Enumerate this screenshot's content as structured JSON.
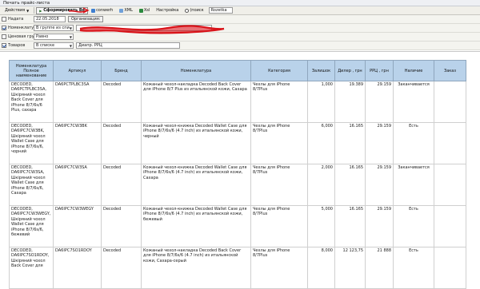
{
  "window": {
    "title": "Печать прайс-листа"
  },
  "toolbar": {
    "actions_label": "Действия",
    "generate_label": "Сформировать Ве",
    "convert_label": "conwerh",
    "xml_label": "XML",
    "xsl_label": "Xsl",
    "settings_label": "Настройка",
    "search_label": "(поиск",
    "search_value": "Rozetka"
  },
  "filters": {
    "as_of": {
      "label": "Надата",
      "checked": false,
      "date": "22.05.2018",
      "button_label": "Организация:"
    },
    "nomenclature": {
      "label": "Номенклатура",
      "checked": true,
      "mode": "В группе из спи"
    },
    "price_group": {
      "label": "Ценовая группа",
      "checked": false,
      "mode": "Равно"
    },
    "goods": {
      "label": "Товаров",
      "checked": true,
      "mode": "В списке",
      "value": "Диапр. РРЦ"
    }
  },
  "table": {
    "columns": [
      "Номенклатура Полное наименование",
      "Артикул",
      "Бренд",
      "Номенклатура",
      "Категория",
      "Залишок",
      "Дилер , грн",
      "РРЦ , грн",
      "Наличие",
      "Заказ"
    ],
    "rows": [
      {
        "full_name": "DECODED, DA6PCTPLBC3SA, Шкіряний чохол Back Cover для iPhone 8/7/6s/6 Plus, сахара",
        "article": "DA6PCTPLBC3SA",
        "brand": "Decoded",
        "name": "Кожаный чехол-накладка Decoded Back Cover для iPhone 8/7 Plus из итальянской кожи, Сахара",
        "category": "Чехлы для iPhone 8/7Plus",
        "stock": "1,000",
        "dealer": "19.389",
        "rrp": "29.159",
        "availability": "Заканчивается",
        "order": ""
      },
      {
        "full_name": "DECODED, DA6IPC7CW3BK, Шкіряний чохол Wallet Case для iPhone 8/7/6s/6, чорний",
        "article": "DA6IPC7CW3BK",
        "brand": "Decoded",
        "name": "Кожаный чехол-книжка Decoded Wallet Case для iPhone 8/7/6s/6 (4.7 inch) из итальянской кожи, черный",
        "category": "Чехлы для iPhone 8/7Plus",
        "stock": "6,000",
        "dealer": "16.165",
        "rrp": "29.159",
        "availability": "Есть",
        "order": ""
      },
      {
        "full_name": "DECODED, DA6IPC7CW3SA, Шкіряний чохол Wallet Case для iPhone 8/7/6s/6, Сахара",
        "article": "DA6IPC7CW3SA",
        "brand": "Decoded",
        "name": "Кожаный чехол-книжка Decoded Wallet Case для iPhone 8/7/6s/6 (4.7 inch) из итальянской кожи, Сахара",
        "category": "Чехлы для iPhone 8/7Plus",
        "stock": "2,000",
        "dealer": "16.165",
        "rrp": "29.159",
        "availability": "Заканчивается",
        "order": ""
      },
      {
        "full_name": "DECODED, DA6IPC7CW3WEGY, Шкіряний чохол Wallet Case для iPhone 8/7/6s/6, бежевий",
        "article": "DA6IPC7CW3WEGY",
        "brand": "Decoded",
        "name": "Кожаный чехол-книжка Decoded Wallet Case для iPhone 8/7/6s/6 (4.7 inch) из итальянской кожи, бежевый",
        "category": "Чехлы для iPhone 8/7Plus",
        "stock": "5,000",
        "dealer": "16.165",
        "rrp": "29.159",
        "availability": "Есть",
        "order": ""
      },
      {
        "full_name": "DECODED, DA6IPC7SO1RDOY, Шкіряний чохол Back Cover для",
        "article": "DA6IPC7SO1RDOY",
        "brand": "Decoded",
        "name": "Кожаный чехол-накладка Decoded Back Cover для iPhone 8/7/6s/6 (4.7 inch) из итальянской кожи, Сахара-серый",
        "category": "Чехлы для iPhone 8/7Plus",
        "stock": "8,000",
        "dealer": "12 123,75",
        "rrp": "21 888",
        "availability": "Есть",
        "order": ""
      }
    ]
  },
  "colors": {
    "header_bg": "#b9d2ea",
    "toolbar_bg": "#f0efe9",
    "scribble": "#d9141a"
  }
}
